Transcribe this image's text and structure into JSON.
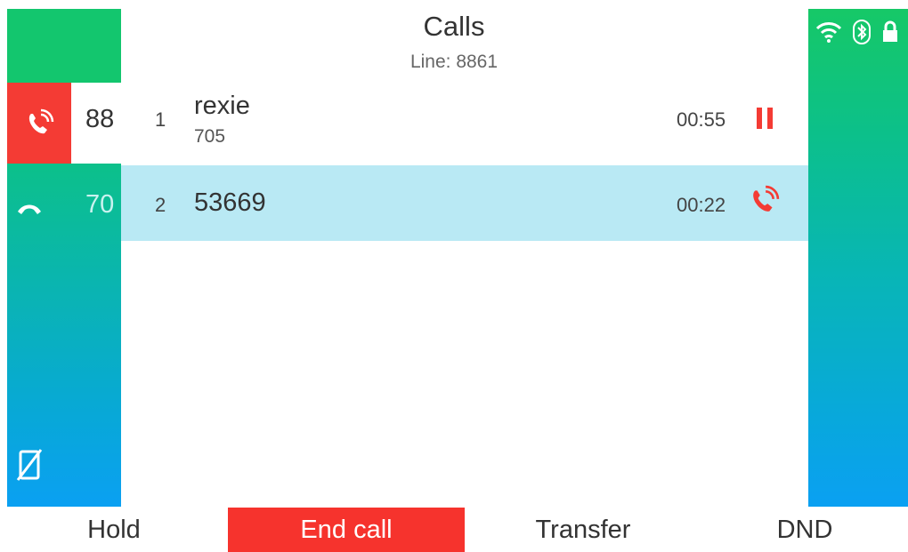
{
  "header": {
    "title": "Calls",
    "line": "Line: 8861"
  },
  "lines": [
    {
      "label": "88",
      "icon": "call-active-icon",
      "color": "#f43b34"
    },
    {
      "label": "70",
      "icon": "handset-icon"
    }
  ],
  "sidebar_bottom_icon": "no-phone-icon",
  "status": [
    "wifi-icon",
    "bluetooth-icon",
    "lock-icon"
  ],
  "calls": [
    {
      "index": "1",
      "name": "rexie",
      "number": "705",
      "duration": "00:55",
      "state_icon": "hold-icon"
    },
    {
      "index": "2",
      "name": "53669",
      "duration": "00:22",
      "state_icon": "active-call-icon"
    }
  ],
  "softkeys": {
    "hold": "Hold",
    "end_call": "End call",
    "transfer": "Transfer",
    "dnd": "DND"
  },
  "colors": {
    "end_call": "#f6332d",
    "selected_row": "#b9e9f4",
    "accent_red": "#f43b34"
  }
}
